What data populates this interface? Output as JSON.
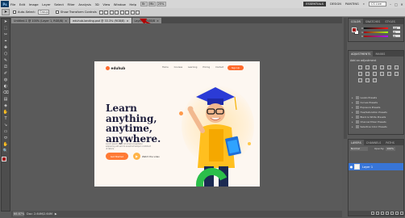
{
  "app": {
    "logo": "Ps"
  },
  "menu": {
    "items": [
      "File",
      "Edit",
      "Image",
      "Layer",
      "Select",
      "Filter",
      "Analysis",
      "3D",
      "View",
      "Window",
      "Help"
    ],
    "bridge_btn": "Br",
    "mini_btn": "Mb",
    "zoom_label": "25%"
  },
  "workspaces": {
    "active": "ESSENTIALS",
    "design": "DESIGN",
    "painting": "PAINTING",
    "more": "»"
  },
  "cs_search": "CS Live",
  "window_controls": {
    "minimize": "–",
    "restore": "□",
    "close": "✕"
  },
  "options": {
    "auto_select_label": "Auto-Select:",
    "auto_select_value": "Group",
    "show_transform": "Show Transform Controls"
  },
  "tabs": [
    {
      "label": "Untitled-1 @ 100% (Layer 1, RGB/8)",
      "close": "×"
    },
    {
      "label": "eduhub-landing.psd @ 33.3% (RGB/8)",
      "close": "×"
    },
    {
      "label": "Layer 1, RGB/8",
      "close": "×"
    }
  ],
  "tools": [
    "➤",
    "⬚",
    "✂",
    "⌖",
    "✚",
    "⬡",
    "✎",
    "⎚",
    "✐",
    "◍",
    "◐",
    "⌫",
    "▤",
    "◈",
    "✋",
    "T",
    "↘",
    "▭",
    "⬭",
    "✋",
    "🔍"
  ],
  "site": {
    "logo_text": "eduhub",
    "nav": [
      "Home",
      "Courses",
      "Learning",
      "Pricing",
      "Contact"
    ],
    "nav_cta": "Sign Up",
    "headline_1": "Learn anything,",
    "headline_2": "anytime,",
    "headline_3": "anywhere.",
    "subtext": "Lorem ipsum dolor sit amet consectetur adipiscing elit sed do eiusmod tempor incididunt ut labore",
    "cta": "Get Started",
    "play": "▶",
    "watch": "Watch the video"
  },
  "status": {
    "zoom": "66.67%",
    "doc": "Doc: 2.64M/2.64M",
    "arrow": "▶"
  },
  "color_panel": {
    "tabs": [
      "COLOR",
      "SWATCHES",
      "STYLES"
    ],
    "r_label": "R",
    "g_label": "G",
    "b_label": "B",
    "r_value": "163",
    "g_value": "21",
    "b_value": "21",
    "fg_color": "#a31515",
    "bg_color": "#ffffff"
  },
  "adjust_panel": {
    "tabs": [
      "ADJUSTMENTS",
      "MASKS"
    ],
    "title": "Add an adjustment",
    "presets": [
      "Levels Presets",
      "Curves Presets",
      "Exposure Presets",
      "Hue/Saturation Presets",
      "Black & White Presets",
      "Channel Mixer Presets",
      "Selective Color Presets"
    ]
  },
  "layers_panel": {
    "tabs": [
      "LAYERS",
      "CHANNELS",
      "PATHS"
    ],
    "blend": "Normal",
    "opacity_label": "Opacity:",
    "opacity_value": "100%",
    "layer_name": "Layer 1"
  },
  "colors": {
    "accent": "#ff6a2b",
    "selection": "#3875d7",
    "annotation_arrow": "#b00000"
  }
}
